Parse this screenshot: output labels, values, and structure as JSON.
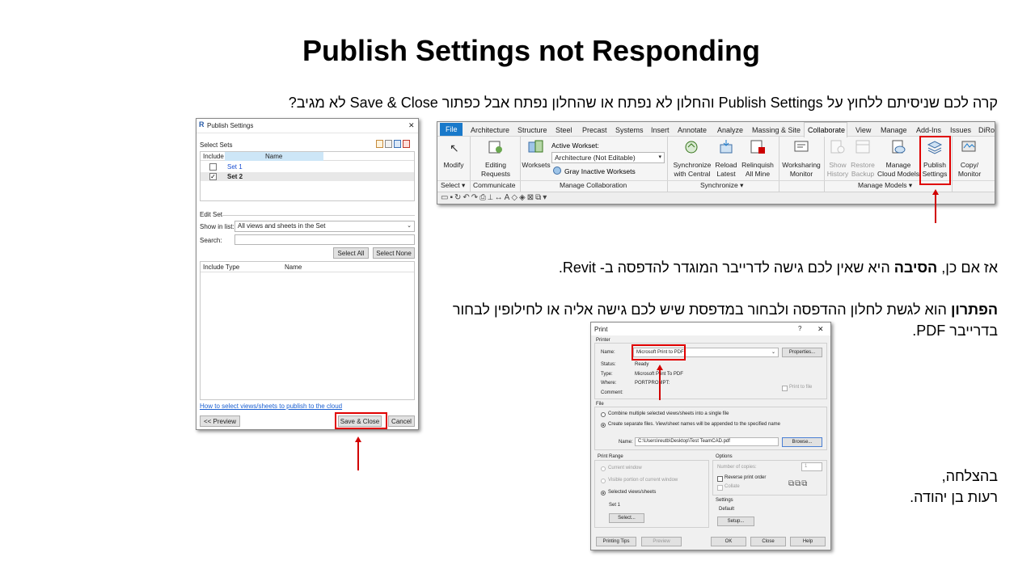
{
  "slide": {
    "title": "Publish Settings not Responding",
    "line1": "קרה לכם שניסיתם ללחוץ על Publish Settings והחלון לא נפתח או שהחלון נפתח אבל כפתור Save & Close לא מגיב?",
    "reason_pre": "אז אם כן, ",
    "reason_bold": "הסיבה",
    "reason_post": " היא שאין לכם גישה לדרייבר המוגדר להדפסה ב- Revit.",
    "solution_bold": "הפתרון",
    "solution_post": " הוא לגשת לחלון ההדפסה ולבחור במדפסת שיש לכם גישה אליה או לחילופין לבחור בדרייבר PDF.",
    "closing1": "בהצלחה,",
    "closing2": "רעות בן יהודה."
  },
  "publish_dialog": {
    "title": "Publish Settings",
    "close": "✕",
    "select_sets": "Select Sets",
    "col_include": "Include",
    "col_name": "Name",
    "sets": [
      {
        "name": "Set 1",
        "checked": false
      },
      {
        "name": "Set 2",
        "checked": true
      }
    ],
    "edit_set": "Edit Set",
    "show_in_list_label": "Show in list:",
    "show_in_list_value": "All views and sheets in the Set",
    "search_label": "Search:",
    "select_all": "Select All",
    "select_none": "Select None",
    "col_include_type": "Include Type",
    "col_name2": "Name",
    "help_link": "How to select views/sheets to publish to the cloud",
    "preview": "<< Preview",
    "save_close": "Save & Close",
    "cancel": "Cancel"
  },
  "ribbon": {
    "tabs": [
      "File",
      "Architecture",
      "Structure",
      "Steel",
      "Precast",
      "Systems",
      "Insert",
      "Annotate",
      "Analyze",
      "Massing & Site",
      "Collaborate",
      "View",
      "Manage",
      "Add-Ins",
      "Issues",
      "DiRoots"
    ],
    "active_tab": "Collaborate",
    "modify": "Modify",
    "editing_requests_1": "Editing",
    "editing_requests_2": "Requests",
    "worksets": "Worksets",
    "active_workset_label": "Active Workset:",
    "active_workset_value": "Architecture (Not Editable)",
    "gray_inactive": "Gray Inactive Worksets",
    "sync_1": "Synchronize",
    "sync_2": "with Central",
    "reload_1": "Reload",
    "reload_2": "Latest",
    "relinquish_1": "Relinquish",
    "relinquish_2": "All Mine",
    "ws_monitor_1": "Worksharing",
    "ws_monitor_2": "Monitor",
    "show_history_1": "Show",
    "show_history_2": "History",
    "restore_backup_1": "Restore",
    "restore_backup_2": "Backup",
    "manage_cloud_1": "Manage",
    "manage_cloud_2": "Cloud Models",
    "publish_1": "Publish",
    "publish_2": "Settings",
    "copy_monitor_1": "Copy/",
    "copy_monitor_2": "Monitor",
    "grp_select": "Select",
    "grp_communicate": "Communicate",
    "grp_manage_collab": "Manage Collaboration",
    "grp_synchronize": "Synchronize",
    "grp_manage_models": "Manage Models"
  },
  "print_dialog": {
    "title": "Print",
    "help": "?",
    "close": "✕",
    "printer_group": "Printer",
    "name_label": "Name:",
    "printer_name": "Microsoft Print to PDF",
    "properties": "Properties...",
    "status_label": "Status:",
    "status_value": "Ready",
    "type_label": "Type:",
    "type_value": "Microsoft Print To PDF",
    "where_label": "Where:",
    "where_value": "PORTPROMPT:",
    "comment_label": "Comment:",
    "print_to_file": "Print to file",
    "file_group": "File",
    "combine_label": "Combine multiple selected views/sheets into a single file",
    "separate_label": "Create separate files. View/sheet names will be appended to the specified name",
    "file_name_label": "Name:",
    "file_name_value": "C:\\Users\\reutb\\Desktop\\Test TeamCAD.pdf",
    "browse": "Browse...",
    "print_range": "Print Range",
    "current_window": "Current window",
    "visible_portion": "Visible portion of current window",
    "selected_views": "Selected views/sheets",
    "set_name": "Set 1",
    "select_btn": "Select...",
    "options": "Options",
    "num_copies": "Number of copies:",
    "copies_value": "1",
    "reverse_order": "Reverse print order",
    "collate": "Collate",
    "settings": "Settings",
    "settings_value": "Default",
    "setup": "Setup...",
    "printing_tips": "Printing Tips",
    "preview": "Preview",
    "ok": "OK",
    "close_btn": "Close",
    "help_btn": "Help"
  },
  "colors": {
    "accent_red": "#e00000",
    "file_tab_blue": "#1979ca",
    "link_blue": "#0066cc"
  }
}
